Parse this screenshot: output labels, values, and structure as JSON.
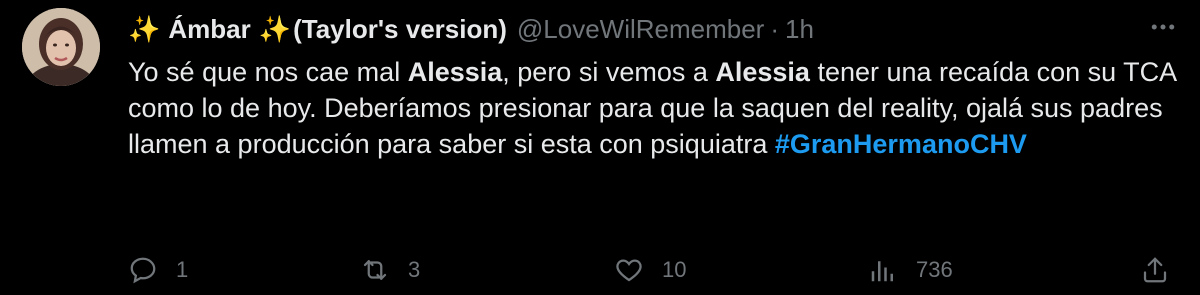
{
  "tweet": {
    "sparkle_left": "✨",
    "name": "Ámbar",
    "sparkle_right": "✨",
    "name_suffix": "(Taylor's version)",
    "handle": "@LoveWilRemember",
    "separator": "·",
    "time": "1h",
    "more_icon": "ellipsis-icon",
    "text": {
      "p1": "Yo sé que nos cae mal ",
      "b1": "Alessia",
      "p2": ", pero si vemos a ",
      "b2": "Alessia",
      "p3": " tener una recaída con su TCA como lo de hoy. Deberíamos presionar para que la saquen del reality, ojalá sus padres llamen a producción para saber si esta con psiquiatra ",
      "hashtag": "#GranHermanoCHV"
    },
    "actions": {
      "reply_count": "1",
      "retweet_count": "3",
      "like_count": "10",
      "views_count": "736"
    }
  },
  "colors": {
    "background": "#000000",
    "text": "#e7e9ea",
    "muted": "#71767b",
    "link": "#1d9bf0",
    "sparkle": "#f7c948"
  }
}
